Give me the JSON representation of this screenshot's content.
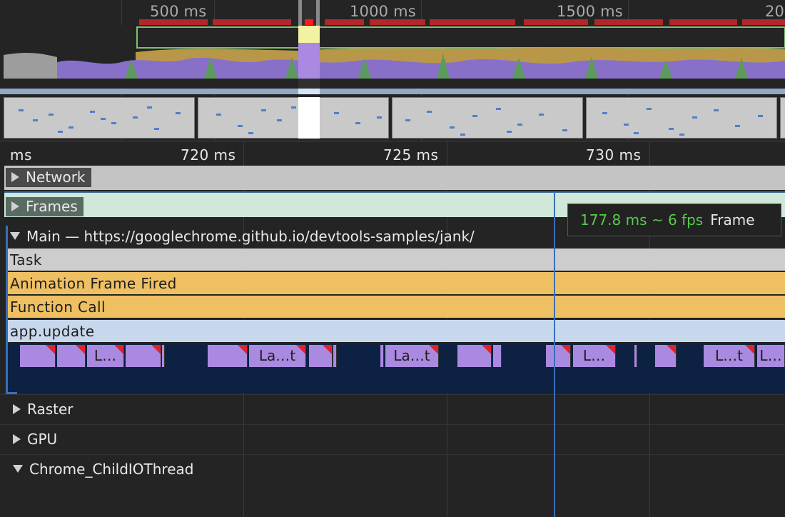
{
  "overview": {
    "ticks": [
      "500 ms",
      "1000 ms",
      "1500 ms",
      "20"
    ]
  },
  "ruler": {
    "labels": [
      "ms",
      "720 ms",
      "725 ms",
      "730 ms"
    ]
  },
  "tracks": {
    "network": "Network",
    "frames": "Frames",
    "main": "Main — https://googlechrome.github.io/devtools-samples/jank/",
    "raster": "Raster",
    "gpu": "GPU",
    "child_io": "Chrome_ChildIOThread"
  },
  "flame": {
    "task": "Task",
    "animation_frame": "Animation Frame Fired",
    "function_call": "Function Call",
    "app_update": "app.update",
    "labels": [
      "L…",
      "La…t",
      "La…t",
      "L…",
      "L…t",
      "L…"
    ]
  },
  "tooltip": {
    "fps": "177.8 ms ~ 6 fps",
    "kind": "Frame"
  },
  "colors": {
    "fps_bar": "#b3262b",
    "scripting": "#efc062",
    "rendering": "#a98ae0",
    "painting": "#5d9a5d",
    "task": "#cdcdcd",
    "selection": "#3a6fb8"
  }
}
